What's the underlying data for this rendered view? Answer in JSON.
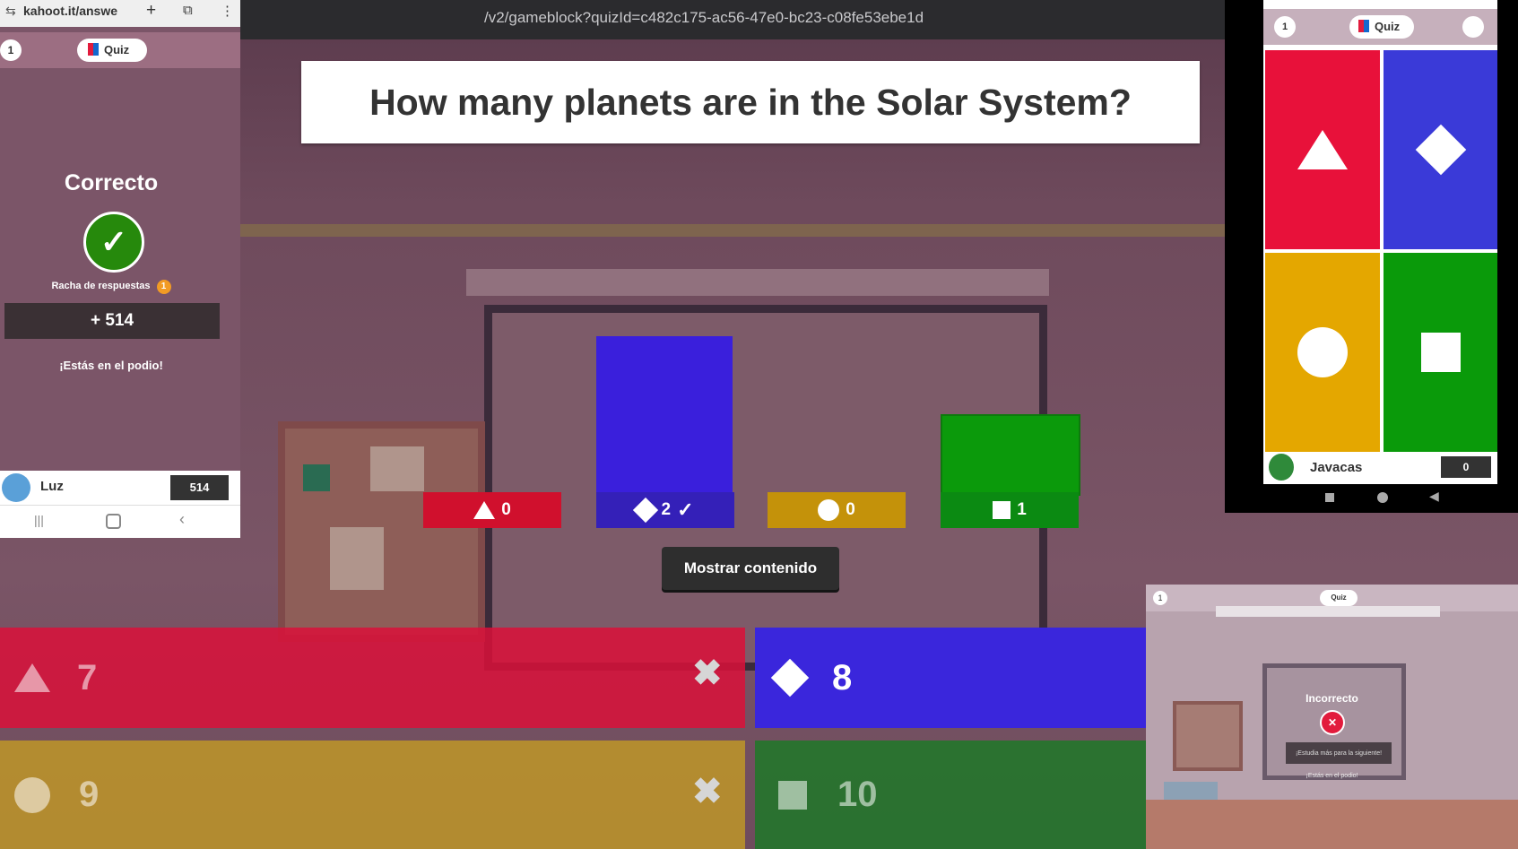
{
  "browser": {
    "url": "/v2/gameblock?quizId=c482c175-ac56-47e0-bc23-c08fe53ebe1d"
  },
  "question": {
    "text": "How many planets are in the Solar System?"
  },
  "results": [
    {
      "shape": "triangle",
      "color": "#e21b3c",
      "count": "0",
      "correct": false
    },
    {
      "shape": "diamond",
      "color": "#3a1fdc",
      "count": "2",
      "correct": true
    },
    {
      "shape": "circle",
      "color": "#d89e00",
      "count": "0",
      "correct": false
    },
    {
      "shape": "square",
      "color": "#0b9a0b",
      "count": "1",
      "correct": false
    }
  ],
  "show_content_label": "Mostrar contenido",
  "answers": [
    {
      "shape": "triangle",
      "text": "7",
      "correct": false
    },
    {
      "shape": "diamond",
      "text": "8",
      "correct": true
    },
    {
      "shape": "circle",
      "text": "9",
      "correct": false
    },
    {
      "shape": "square",
      "text": "10",
      "correct": false
    }
  ],
  "left_phone": {
    "url": "kahoot.it/answe",
    "counter": "1",
    "mode": "Quiz",
    "result_title": "Correcto",
    "streak_label": "Racha de respuestas",
    "streak_count": "1",
    "points": "+ 514",
    "podium_text": "¡Estás en el podio!",
    "player_name": "Luz",
    "player_score": "514"
  },
  "right_phone": {
    "counter": "1",
    "mode": "Quiz",
    "player_name": "Javacas",
    "player_score": "0"
  },
  "inset": {
    "counter": "1",
    "mode": "Quiz",
    "result_title": "Incorrecto",
    "message": "¡Estudia más para la siguiente!",
    "podium_text": "¡Estás en el podio!"
  }
}
